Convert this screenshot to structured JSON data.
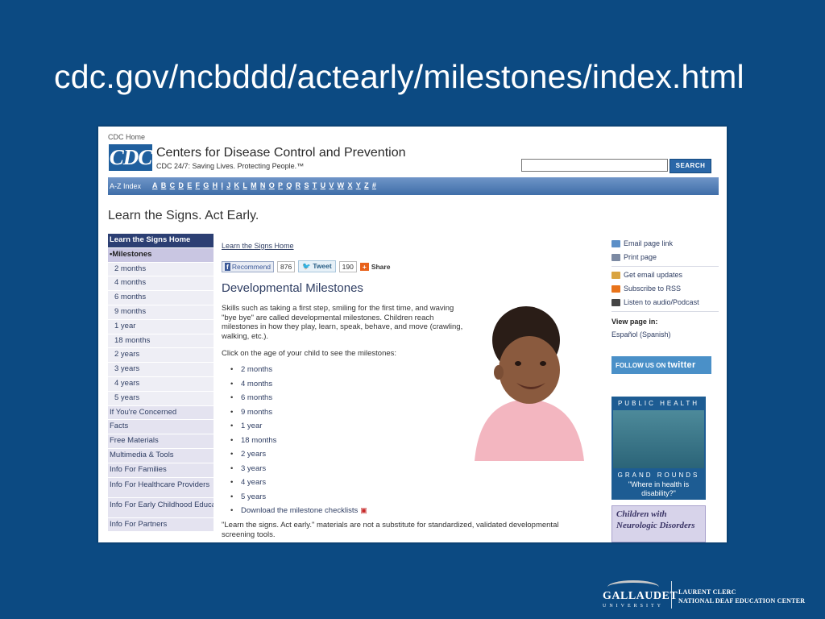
{
  "slide_title": "cdc.gov/ncbddd/actearly/milestones/index.html",
  "header": {
    "cdc_home": "CDC Home",
    "logo_text": "CDC",
    "org_name": "Centers for Disease Control and Prevention",
    "tagline": "CDC 24/7: Saving Lives. Protecting People.™",
    "search_placeholder": "",
    "search_button": "SEARCH"
  },
  "az_bar": {
    "label": "A-Z Index",
    "letters": [
      "A",
      "B",
      "C",
      "D",
      "E",
      "F",
      "G",
      "H",
      "I",
      "J",
      "K",
      "L",
      "M",
      "N",
      "O",
      "P",
      "Q",
      "R",
      "S",
      "T",
      "U",
      "V",
      "W",
      "X",
      "Y",
      "Z",
      "#"
    ]
  },
  "page_banner": "Learn the Signs. Act Early.",
  "left_nav": [
    {
      "label": "Learn the Signs Home",
      "kind": "head"
    },
    {
      "label": "•Milestones",
      "kind": "current"
    },
    {
      "label": "2 months",
      "kind": "sub"
    },
    {
      "label": "4 months",
      "kind": "sub"
    },
    {
      "label": "6 months",
      "kind": "sub"
    },
    {
      "label": "9 months",
      "kind": "sub"
    },
    {
      "label": "1 year",
      "kind": "sub"
    },
    {
      "label": "18 months",
      "kind": "sub"
    },
    {
      "label": "2 years",
      "kind": "sub"
    },
    {
      "label": "3 years",
      "kind": "sub"
    },
    {
      "label": "4 years",
      "kind": "sub"
    },
    {
      "label": "5 years",
      "kind": "sub"
    },
    {
      "label": "If You're Concerned",
      "kind": "item"
    },
    {
      "label": "Facts",
      "kind": "item"
    },
    {
      "label": "Free Materials",
      "kind": "item"
    },
    {
      "label": "Multimedia & Tools",
      "kind": "item"
    },
    {
      "label": "Info For Families",
      "kind": "item"
    },
    {
      "label": "Info For Healthcare Providers",
      "kind": "tall"
    },
    {
      "label": "Info For Early Childhood Educators",
      "kind": "tall"
    },
    {
      "label": "Info For Partners",
      "kind": "item"
    }
  ],
  "main": {
    "breadcrumb": "Learn the Signs Home",
    "social": {
      "recommend": "Recommend",
      "recommend_count": "876",
      "tweet": "Tweet",
      "tweet_count": "190",
      "share": "Share"
    },
    "heading": "Developmental Milestones",
    "intro": "Skills such as taking a first step, smiling for the first time, and waving \"bye bye\" are called developmental milestones. Children reach milestones in how they play, learn, speak, behave, and move (crawling, walking, etc.).",
    "lead": "Click on the age of your child to see the milestones:",
    "ages": [
      "2 months",
      "4 months",
      "6 months",
      "9 months",
      "1 year",
      "18 months",
      "2 years",
      "3 years",
      "4 years",
      "5 years"
    ],
    "download": "Download the milestone checklists",
    "disclaimer": "\"Learn the signs. Act early.\" materials are not a substitute for standardized, validated developmental screening tools."
  },
  "right_col": {
    "links": [
      {
        "label": "Email page link",
        "icon": "email-icon",
        "color": "#5b8fc7"
      },
      {
        "label": "Print page",
        "icon": "print-icon",
        "color": "#7c8aa3"
      },
      {
        "label": "Get email updates",
        "icon": "updates-icon",
        "color": "#d9a441"
      },
      {
        "label": "Subscribe to RSS",
        "icon": "rss-icon",
        "color": "#e8731a"
      },
      {
        "label": "Listen to audio/Podcast",
        "icon": "headphones-icon",
        "color": "#444444"
      }
    ],
    "view_page_in": "View page in:",
    "espanol": "Español (Spanish)",
    "follow_prefix": "FOLLOW US ON",
    "follow_service": "twitter",
    "phgr_top": "PUBLIC HEALTH",
    "phgr_mid": "GRAND ROUNDS",
    "phgr_caption": "\"Where in health is disability?\"",
    "neuro_banner": "Children with Neurologic Disorders"
  },
  "footer": {
    "gallaudet": "GALLAUDET",
    "university": "UNIVERSITY",
    "center_line1": "LAURENT CLERC",
    "center_line2": "NATIONAL DEAF EDUCATION CENTER"
  }
}
